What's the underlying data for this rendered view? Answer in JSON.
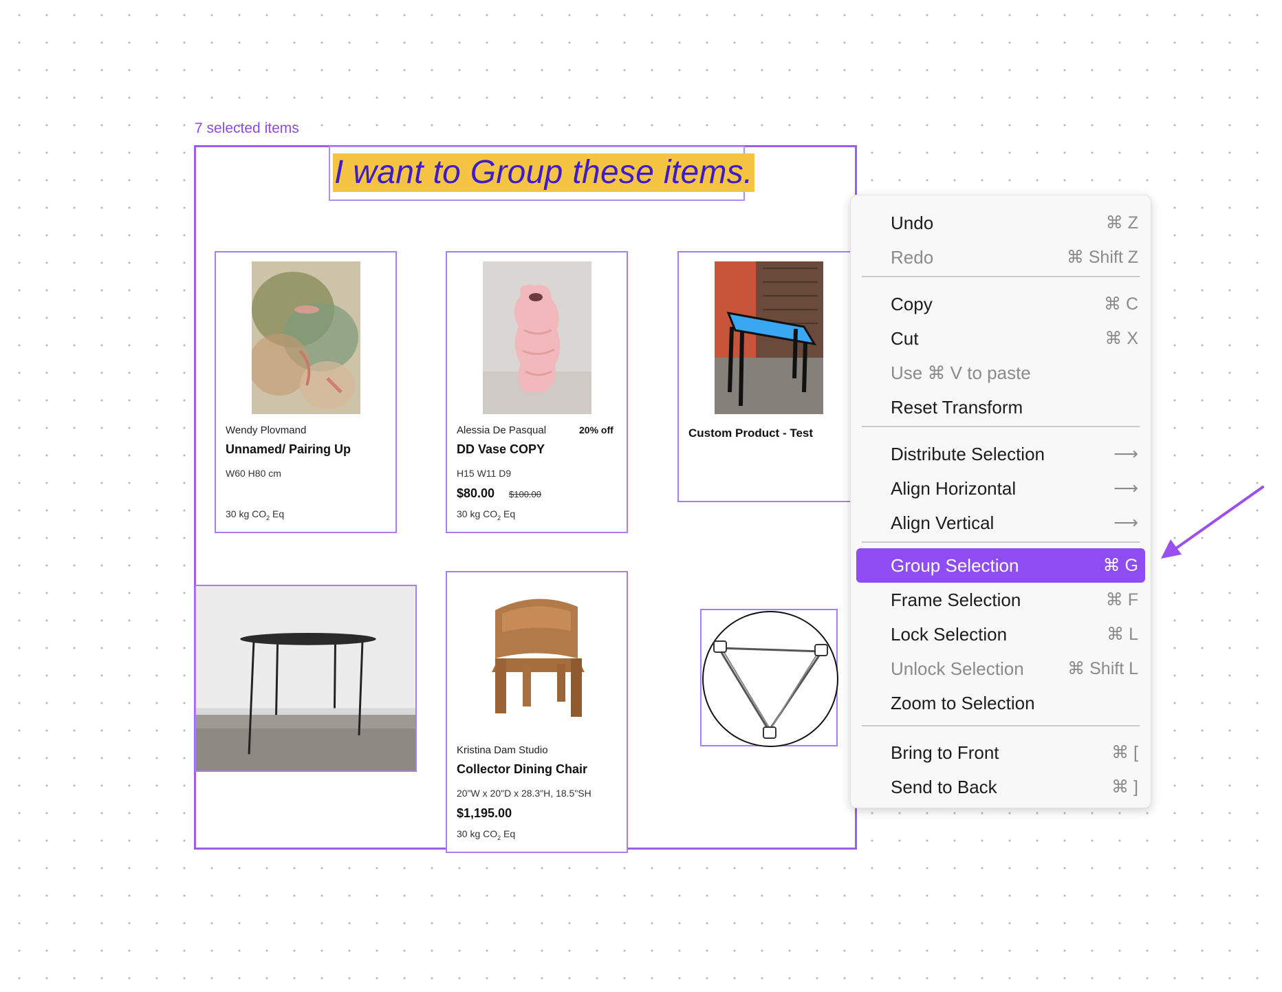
{
  "selection": {
    "label": "7 selected items"
  },
  "heading": "I want to Group these items.",
  "cards": {
    "c1": {
      "artist": "Wendy Plovmand",
      "title": "Unnamed/ Pairing Up",
      "dims": "W60 H80 cm",
      "co2_prefix": "30 kg CO",
      "co2_sub": "2",
      "co2_suffix": " Eq"
    },
    "c2": {
      "artist": "Alessia De Pasqual",
      "badge": "20% off",
      "title": "DD Vase COPY",
      "dims": "H15 W11 D9",
      "price": "$80.00",
      "old_price": "$100.00",
      "co2_prefix": "30 kg CO",
      "co2_sub": "2",
      "co2_suffix": " Eq"
    },
    "c3": {
      "title": "Custom Product - Test"
    },
    "c5": {
      "artist": "Kristina Dam Studio",
      "title": "Collector Dining Chair",
      "dims": "20\"W x 20\"D x 28.3\"H, 18.5\"SH",
      "price": "$1,195.00",
      "co2_prefix": "30 kg CO",
      "co2_sub": "2",
      "co2_suffix": " Eq"
    }
  },
  "menu": {
    "undo": {
      "label": "Undo",
      "shortcut": "⌘ Z"
    },
    "redo": {
      "label": "Redo",
      "shortcut": "⌘ Shift Z"
    },
    "copy": {
      "label": "Copy",
      "shortcut": "⌘ C"
    },
    "cut": {
      "label": "Cut",
      "shortcut": "⌘ X"
    },
    "paste_hint": {
      "label": "Use ⌘ V to paste"
    },
    "reset_transform": {
      "label": "Reset Transform"
    },
    "distribute": {
      "label": "Distribute Selection",
      "icon": "arrow-right-icon"
    },
    "align_h": {
      "label": "Align Horizontal",
      "icon": "arrow-right-icon"
    },
    "align_v": {
      "label": "Align Vertical",
      "icon": "arrow-right-icon"
    },
    "group": {
      "label": "Group Selection",
      "shortcut": "⌘ G"
    },
    "frame": {
      "label": "Frame Selection",
      "shortcut": "⌘ F"
    },
    "lock": {
      "label": "Lock Selection",
      "shortcut": "⌘ L"
    },
    "unlock": {
      "label": "Unlock Selection",
      "shortcut": "⌘ Shift L"
    },
    "zoom": {
      "label": "Zoom to Selection"
    },
    "front": {
      "label": "Bring to Front",
      "shortcut": "⌘ ["
    },
    "back": {
      "label": "Send to Back",
      "shortcut": "⌘ ]"
    }
  },
  "colors": {
    "accent": "#8f4cf2",
    "heading_highlight": "#f6c443",
    "heading_text": "#3d1ccc"
  }
}
